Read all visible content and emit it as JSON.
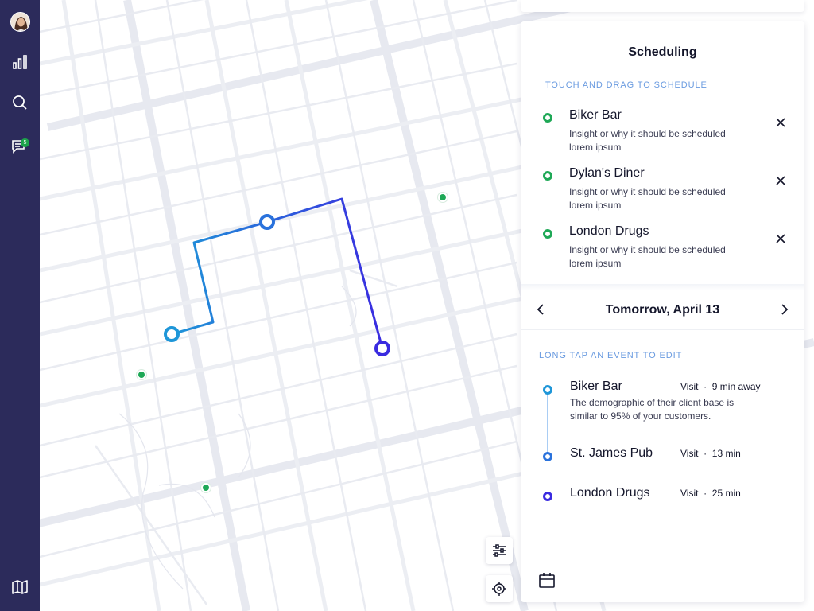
{
  "sidebar": {
    "items": [
      {
        "name": "analytics",
        "icon": "bar-chart-icon"
      },
      {
        "name": "search",
        "icon": "search-icon"
      },
      {
        "name": "messages",
        "icon": "chat-icon",
        "badge": "5"
      },
      {
        "name": "map",
        "icon": "map-icon"
      }
    ]
  },
  "scheduling": {
    "title": "Scheduling",
    "suggestions_label": "TOUCH AND DRAG TO SCHEDULE",
    "suggestions": [
      {
        "name": "Biker Bar",
        "desc": "Insight or why it should be scheduled lorem ipsum"
      },
      {
        "name": "Dylan's Diner",
        "desc": "Insight or why it should be scheduled lorem ipsum"
      },
      {
        "name": "London Drugs",
        "desc": "Insight or why it should be scheduled lorem ipsum"
      }
    ],
    "date": "Tomorrow, April 13",
    "events_label": "LONG TAP AN EVENT TO EDIT",
    "events": [
      {
        "name": "Biker Bar",
        "type": "Visit",
        "time": "9 min away",
        "desc": "The demographic of their client base is similar to 95% of your customers."
      },
      {
        "name": "St. James Pub",
        "type": "Visit",
        "time": "13 min",
        "desc": ""
      },
      {
        "name": "London Drugs",
        "type": "Visit",
        "time": "25 min",
        "desc": ""
      }
    ]
  },
  "colors": {
    "sidebar": "#2c2b5b",
    "accent_blue": "#6a9be0",
    "suggestion_green": "#1ea856",
    "route_start": "#1e96d8",
    "route_end": "#3a2be0"
  }
}
